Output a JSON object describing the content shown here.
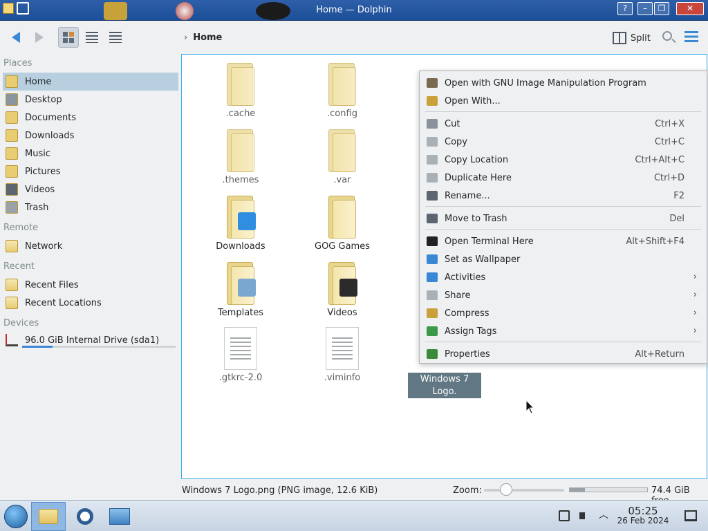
{
  "window": {
    "title": "Home — Dolphin"
  },
  "toolbar": {
    "breadcrumb": "Home",
    "split_label": "Split",
    "chevron": "›"
  },
  "sidebar": {
    "sections": {
      "places": "Places",
      "remote": "Remote",
      "recent": "Recent",
      "devices": "Devices"
    },
    "places": [
      {
        "label": "Home",
        "icon": "home-folder-icon",
        "selected": true
      },
      {
        "label": "Desktop",
        "icon": "desktop-icon"
      },
      {
        "label": "Documents",
        "icon": "documents-folder-icon"
      },
      {
        "label": "Downloads",
        "icon": "downloads-folder-icon"
      },
      {
        "label": "Music",
        "icon": "music-folder-icon"
      },
      {
        "label": "Pictures",
        "icon": "pictures-folder-icon"
      },
      {
        "label": "Videos",
        "icon": "videos-folder-icon"
      },
      {
        "label": "Trash",
        "icon": "trash-icon"
      }
    ],
    "remote": [
      {
        "label": "Network",
        "icon": "network-folder-icon"
      }
    ],
    "recent": [
      {
        "label": "Recent Files",
        "icon": "recent-files-icon"
      },
      {
        "label": "Recent Locations",
        "icon": "recent-locations-icon"
      }
    ],
    "devices": [
      {
        "label": "96.0 GiB Internal Drive (sda1)",
        "icon": "drive-icon",
        "usage_fraction": 0.2
      }
    ]
  },
  "files": [
    {
      "name": ".cache",
      "type": "folder",
      "hidden": true
    },
    {
      "name": ".config",
      "type": "folder",
      "hidden": true
    },
    {
      "name": ".themes",
      "type": "folder",
      "hidden": true
    },
    {
      "name": ".var",
      "type": "folder",
      "hidden": true
    },
    {
      "name": "Downloads",
      "type": "folder"
    },
    {
      "name": "GOG Games",
      "type": "folder"
    },
    {
      "name": "Templates",
      "type": "folder"
    },
    {
      "name": "Videos",
      "type": "folder"
    },
    {
      "name": ".gtkrc-2.0",
      "type": "text"
    },
    {
      "name": ".viminfo",
      "type": "text"
    },
    {
      "name": "Windows 7 Logo.\npng",
      "type": "image",
      "selected": true
    }
  ],
  "context_menu": {
    "items": [
      {
        "label": "Open with GNU Image Manipulation Program",
        "icon": "gimp-icon",
        "shortcut": ""
      },
      {
        "label": "Open With...",
        "icon": "open-with-icon",
        "shortcut": ""
      },
      {
        "label": "Cut",
        "icon": "scissors-icon",
        "shortcut": "Ctrl+X"
      },
      {
        "label": "Copy",
        "icon": "copy-icon",
        "shortcut": "Ctrl+C"
      },
      {
        "label": "Copy Location",
        "icon": "copy-location-icon",
        "shortcut": "Ctrl+Alt+C"
      },
      {
        "label": "Duplicate Here",
        "icon": "duplicate-icon",
        "shortcut": "Ctrl+D"
      },
      {
        "label": "Rename...",
        "icon": "rename-icon",
        "shortcut": "F2"
      },
      {
        "label": "Move to Trash",
        "icon": "trash-icon",
        "shortcut": "Del"
      },
      {
        "label": "Open Terminal Here",
        "icon": "terminal-icon",
        "shortcut": "Alt+Shift+F4"
      },
      {
        "label": "Set as Wallpaper",
        "icon": "wallpaper-icon",
        "shortcut": ""
      },
      {
        "label": "Activities",
        "icon": "activities-icon",
        "submenu": true
      },
      {
        "label": "Share",
        "icon": "share-icon",
        "submenu": true
      },
      {
        "label": "Compress",
        "icon": "compress-icon",
        "submenu": true
      },
      {
        "label": "Assign Tags",
        "icon": "tag-icon",
        "submenu": true
      },
      {
        "label": "Properties",
        "icon": "properties-icon",
        "shortcut": "Alt+Return"
      }
    ],
    "submenu_arrow": "›"
  },
  "statusbar": {
    "selection_info": "Windows 7 Logo.png (PNG image, 12.6 KiB)",
    "zoom_label": "Zoom:",
    "zoom_level_fraction": 0.3,
    "free_space": "74.4 GiB free",
    "used_fraction": 0.2
  },
  "taskbar": {
    "time": "05:25",
    "date": "26 Feb 2024"
  },
  "colors": {
    "accent": "#3daee9",
    "selection": "#617783",
    "titlebar": "#1c4f99"
  }
}
